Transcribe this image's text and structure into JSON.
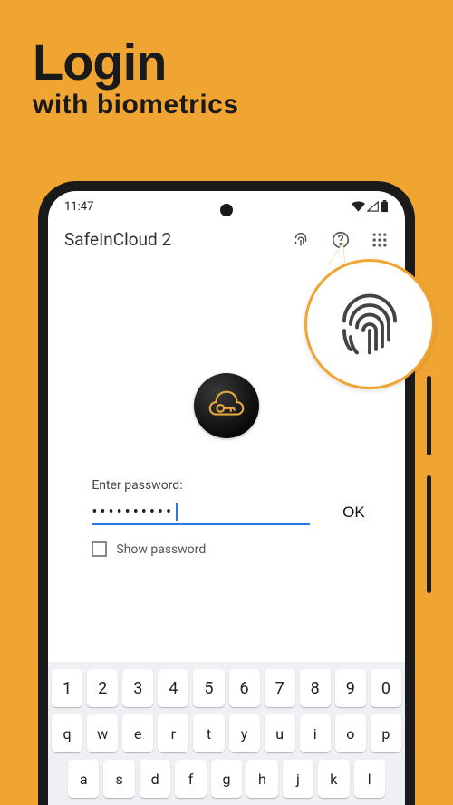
{
  "promo": {
    "title": "Login",
    "subtitle": "with biometrics"
  },
  "status": {
    "time": "11:47"
  },
  "appbar": {
    "title": "SafeInCloud 2"
  },
  "form": {
    "label": "Enter password:",
    "masked": "••••••••••",
    "ok": "OK",
    "show_pwd": "Show password"
  },
  "keyboard": {
    "row1": [
      "1",
      "2",
      "3",
      "4",
      "5",
      "6",
      "7",
      "8",
      "9",
      "0"
    ],
    "row2": [
      "q",
      "w",
      "e",
      "r",
      "t",
      "y",
      "u",
      "i",
      "o",
      "p"
    ],
    "row3": [
      "a",
      "s",
      "d",
      "f",
      "g",
      "h",
      "j",
      "k",
      "l"
    ]
  }
}
